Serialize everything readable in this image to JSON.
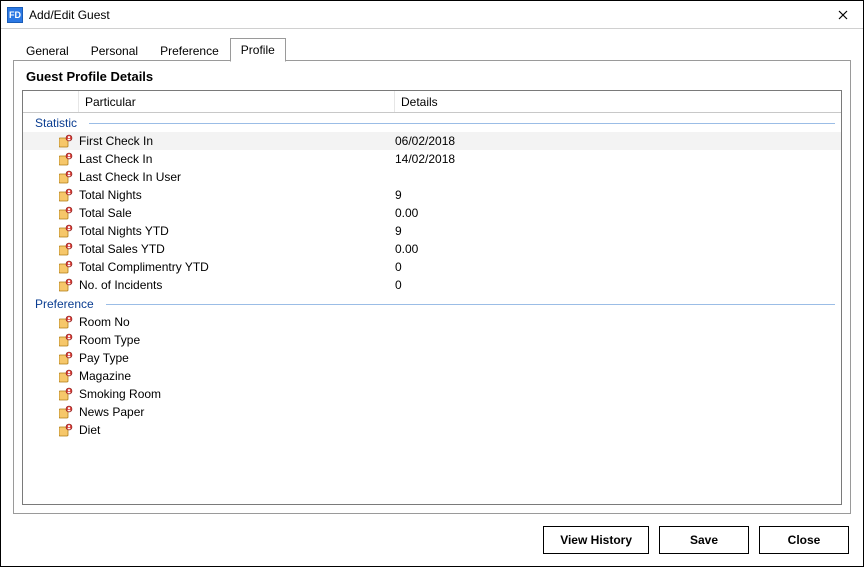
{
  "window": {
    "title": "Add/Edit Guest",
    "app_icon_label": "FD"
  },
  "tabs": [
    {
      "label": "General",
      "active": false
    },
    {
      "label": "Personal",
      "active": false
    },
    {
      "label": "Preference",
      "active": false
    },
    {
      "label": "Profile",
      "active": true
    }
  ],
  "panel_title": "Guest Profile Details",
  "columns": {
    "particular": "Particular",
    "details": "Details"
  },
  "groups": [
    {
      "name": "Statistic",
      "rows": [
        {
          "particular": "First Check In",
          "details": "06/02/2018",
          "alt": true
        },
        {
          "particular": "Last Check In",
          "details": "14/02/2018",
          "alt": false
        },
        {
          "particular": "Last Check In User",
          "details": "",
          "alt": false
        },
        {
          "particular": "Total Nights",
          "details": "9",
          "alt": false
        },
        {
          "particular": "Total Sale",
          "details": "0.00",
          "alt": false
        },
        {
          "particular": "Total Nights YTD",
          "details": "9",
          "alt": false
        },
        {
          "particular": "Total Sales YTD",
          "details": "0.00",
          "alt": false
        },
        {
          "particular": "Total Complimentry YTD",
          "details": "0",
          "alt": false
        },
        {
          "particular": "No. of Incidents",
          "details": "0",
          "alt": false
        }
      ]
    },
    {
      "name": "Preference",
      "rows": [
        {
          "particular": "Room No",
          "details": "",
          "alt": false
        },
        {
          "particular": "Room Type",
          "details": "",
          "alt": false
        },
        {
          "particular": "Pay Type",
          "details": "",
          "alt": false
        },
        {
          "particular": "Magazine",
          "details": "",
          "alt": false
        },
        {
          "particular": "Smoking Room",
          "details": "",
          "alt": false
        },
        {
          "particular": "News Paper",
          "details": "",
          "alt": false
        },
        {
          "particular": "Diet",
          "details": "",
          "alt": false
        }
      ]
    }
  ],
  "buttons": {
    "view_history": "View History",
    "save": "Save",
    "close": "Close"
  }
}
